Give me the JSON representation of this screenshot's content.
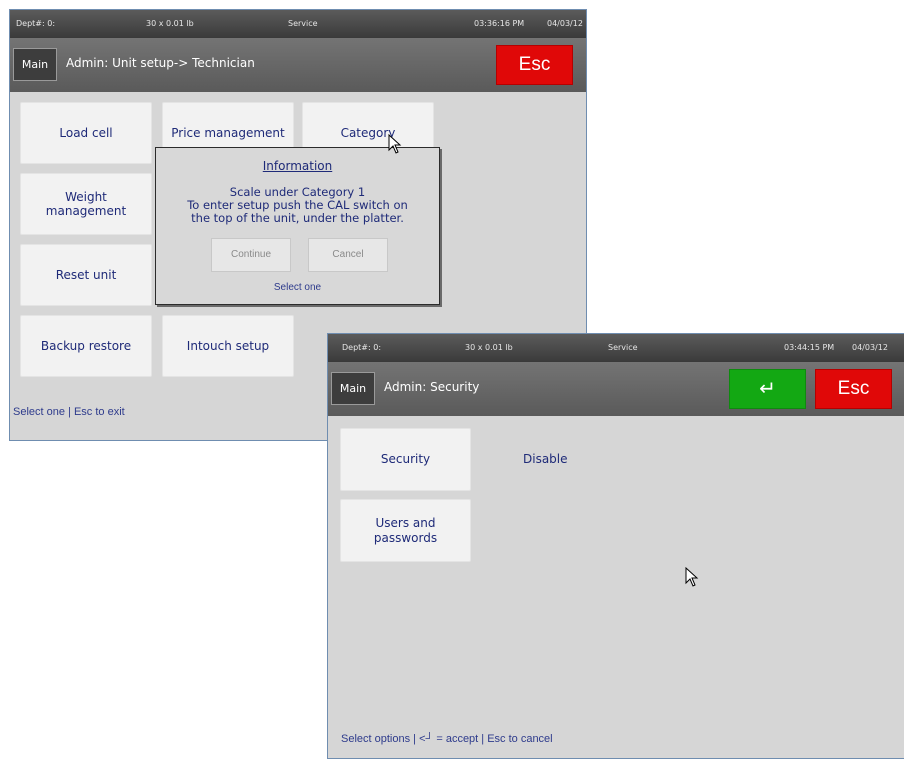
{
  "back_window": {
    "status": {
      "dept": "Dept#: 0:",
      "capacity": "30 x 0.01 lb",
      "mode": "Service",
      "time": "03:36:16 PM",
      "date": "04/03/12"
    },
    "main_label": "Main",
    "title": "Admin: Unit setup-> Technician",
    "esc_label": "Esc",
    "tiles": {
      "load_cell": "Load cell",
      "price_management": "Price management",
      "category": "Category",
      "weight_management": "Weight\nmanagement",
      "reset_unit": "Reset unit",
      "backup_restore": "Backup restore",
      "intouch_setup": "Intouch setup"
    },
    "footer": "Select one | Esc to exit",
    "dialog": {
      "title": "Information",
      "line1": "Scale under Category 1",
      "line2": "To enter setup push the CAL switch on",
      "line3": "the top of the unit, under the platter.",
      "continue_label": "Continue",
      "cancel_label": "Cancel",
      "select_text": "Select one"
    }
  },
  "front_window": {
    "status": {
      "dept": "Dept#: 0:",
      "capacity": "30 x 0.01 lb",
      "mode": "Service",
      "time": "03:44:15 PM",
      "date": "04/03/12"
    },
    "main_label": "Main",
    "title": "Admin: Security",
    "enter_icon": "↵",
    "esc_label": "Esc",
    "tiles": {
      "security": "Security",
      "users_passwords": "Users and\npasswords"
    },
    "security_value": "Disable",
    "footer": "Select options | <┘ = accept | Esc to cancel"
  },
  "colors": {
    "esc": "#e00808",
    "enter": "#13a813",
    "label_text": "#1e2a78",
    "panel_bg": "#d6d6d6"
  }
}
